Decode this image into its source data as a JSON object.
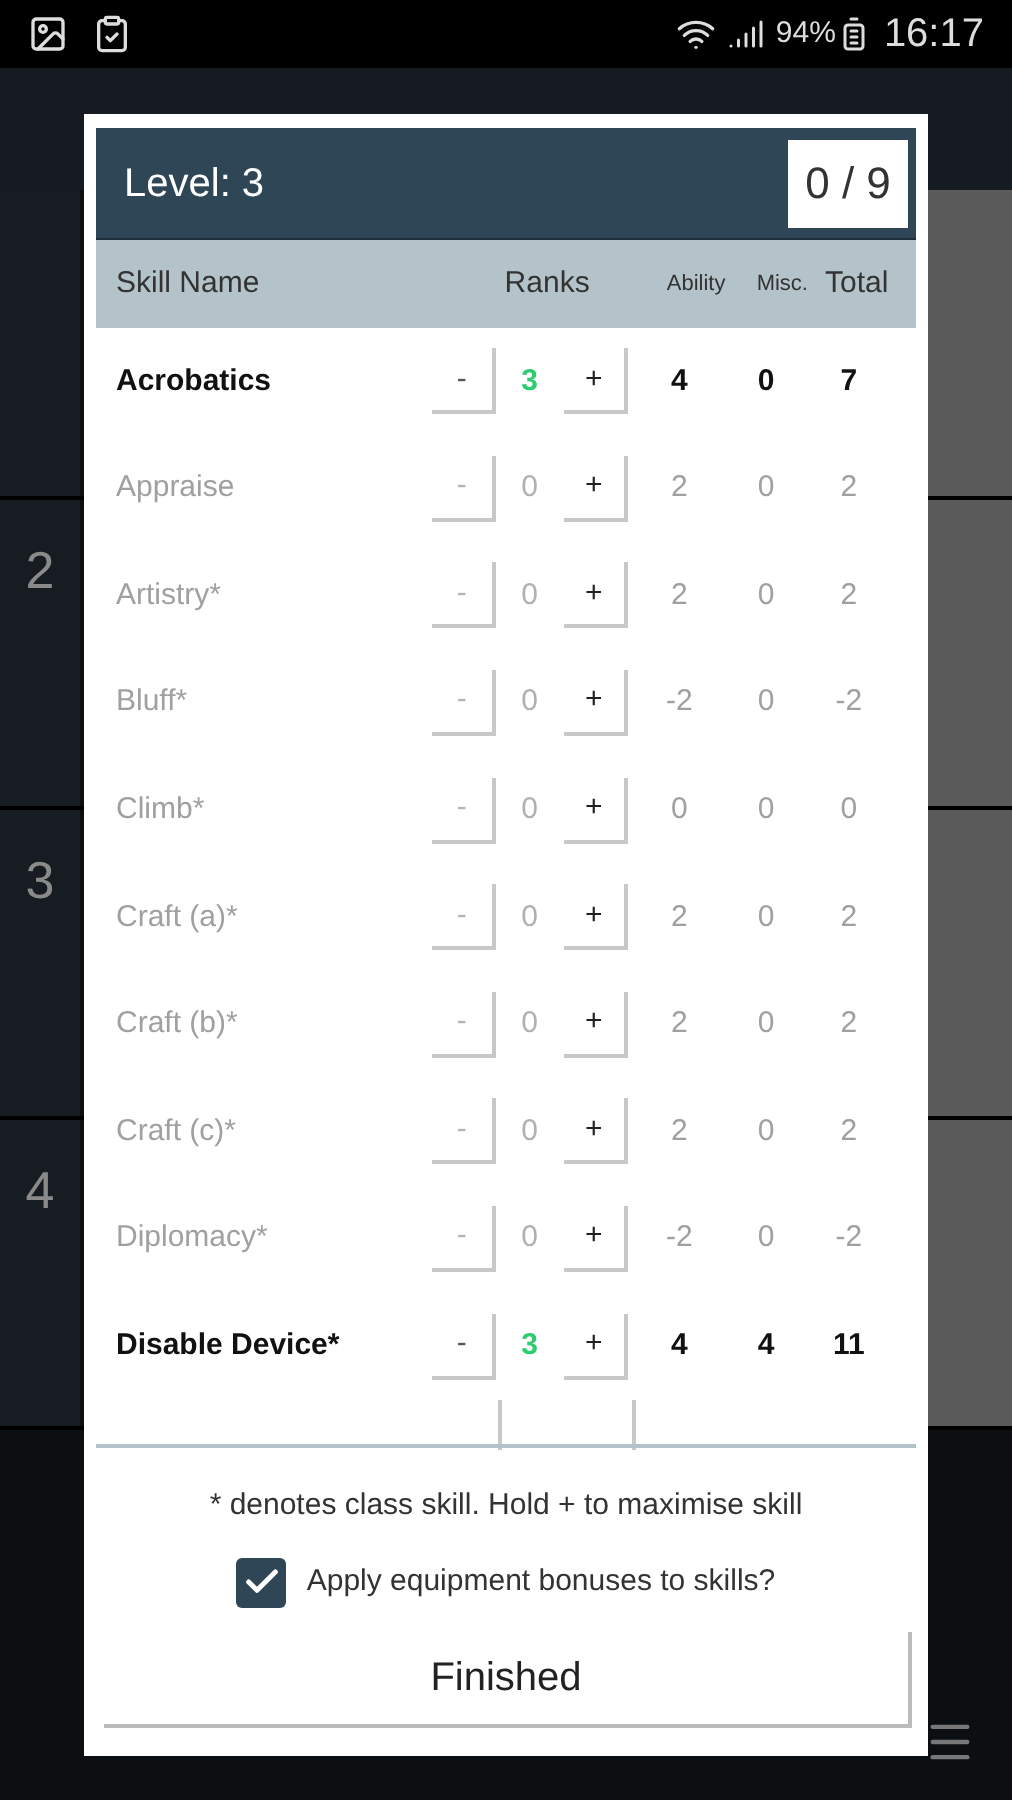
{
  "status_bar": {
    "battery": "94%",
    "time": "16:17"
  },
  "background": {
    "rows": [
      {
        "number": ""
      },
      {
        "number": "2"
      },
      {
        "number": "3"
      },
      {
        "number": "4"
      }
    ]
  },
  "dialog": {
    "level": "Level: 3",
    "points": "0 / 9",
    "columns": {
      "name": "Skill Name",
      "ranks": "Ranks",
      "ability": "Ability",
      "misc": "Misc.",
      "total": "Total"
    },
    "skills": [
      {
        "name": "Acrobatics",
        "trained": true,
        "minus": "-",
        "ranks": "3",
        "plus": "+",
        "ability": "4",
        "misc": "0",
        "total": "7"
      },
      {
        "name": "Appraise",
        "trained": false,
        "minus": "-",
        "ranks": "0",
        "plus": "+",
        "ability": "2",
        "misc": "0",
        "total": "2"
      },
      {
        "name": "Artistry*",
        "trained": false,
        "minus": "-",
        "ranks": "0",
        "plus": "+",
        "ability": "2",
        "misc": "0",
        "total": "2"
      },
      {
        "name": "Bluff*",
        "trained": false,
        "minus": "-",
        "ranks": "0",
        "plus": "+",
        "ability": "-2",
        "misc": "0",
        "total": "-2"
      },
      {
        "name": "Climb*",
        "trained": false,
        "minus": "-",
        "ranks": "0",
        "plus": "+",
        "ability": "0",
        "misc": "0",
        "total": "0"
      },
      {
        "name": "Craft (a)*",
        "trained": false,
        "minus": "-",
        "ranks": "0",
        "plus": "+",
        "ability": "2",
        "misc": "0",
        "total": "2"
      },
      {
        "name": "Craft (b)*",
        "trained": false,
        "minus": "-",
        "ranks": "0",
        "plus": "+",
        "ability": "2",
        "misc": "0",
        "total": "2"
      },
      {
        "name": "Craft (c)*",
        "trained": false,
        "minus": "-",
        "ranks": "0",
        "plus": "+",
        "ability": "2",
        "misc": "0",
        "total": "2"
      },
      {
        "name": "Diplomacy*",
        "trained": false,
        "minus": "-",
        "ranks": "0",
        "plus": "+",
        "ability": "-2",
        "misc": "0",
        "total": "-2"
      },
      {
        "name": "Disable Device*",
        "trained": true,
        "minus": "-",
        "ranks": "3",
        "plus": "+",
        "ability": "4",
        "misc": "4",
        "total": "11"
      }
    ],
    "note": "* denotes class skill. Hold + to maximise skill",
    "equipment": {
      "label": "Apply equipment bonuses to skills?",
      "checked": true
    },
    "finish": "Finished"
  }
}
